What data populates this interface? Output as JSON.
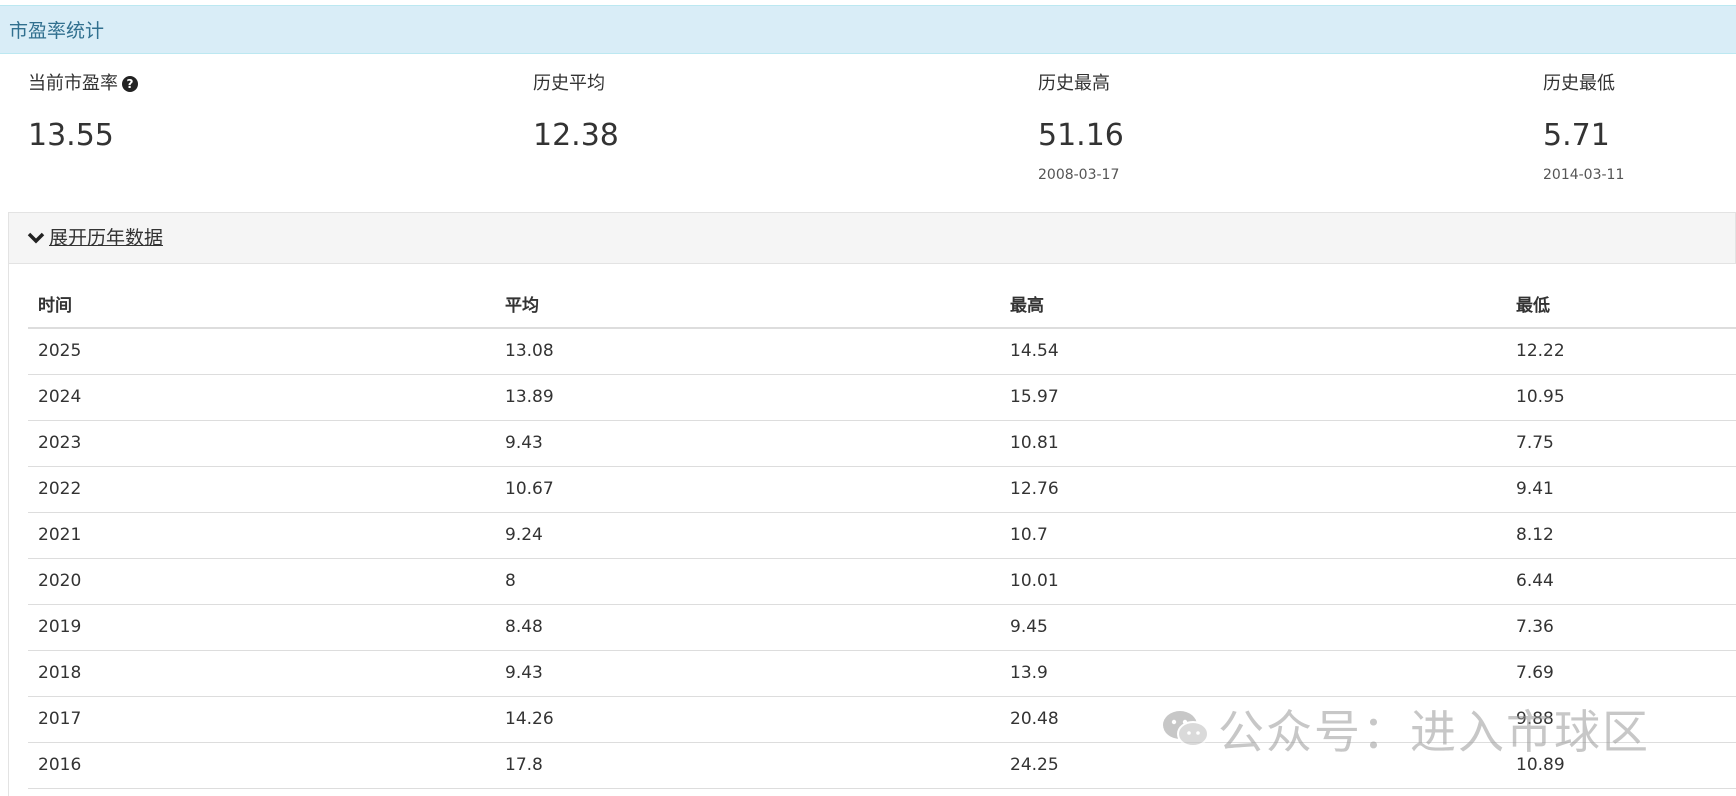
{
  "panel": {
    "title": "市盈率统计"
  },
  "stats": [
    {
      "label": "当前市盈率",
      "value": "13.55",
      "date": ""
    },
    {
      "label": "历史平均",
      "value": "12.38",
      "date": ""
    },
    {
      "label": "历史最高",
      "value": "51.16",
      "date": "2008-03-17"
    },
    {
      "label": "历史最低",
      "value": "5.71",
      "date": "2014-03-11"
    }
  ],
  "expand": {
    "label": "展开历年数据",
    "icon": "chevron-down-icon"
  },
  "table": {
    "headers": [
      "时间",
      "平均",
      "最高",
      "最低"
    ],
    "rows": [
      [
        "2025",
        "13.08",
        "14.54",
        "12.22"
      ],
      [
        "2024",
        "13.89",
        "15.97",
        "10.95"
      ],
      [
        "2023",
        "9.43",
        "10.81",
        "7.75"
      ],
      [
        "2022",
        "10.67",
        "12.76",
        "9.41"
      ],
      [
        "2021",
        "9.24",
        "10.7",
        "8.12"
      ],
      [
        "2020",
        "8",
        "10.01",
        "6.44"
      ],
      [
        "2019",
        "8.48",
        "9.45",
        "7.36"
      ],
      [
        "2018",
        "9.43",
        "13.9",
        "7.69"
      ],
      [
        "2017",
        "14.26",
        "20.48",
        "9.88"
      ],
      [
        "2016",
        "17.8",
        "24.25",
        "10.89"
      ]
    ]
  },
  "watermark": {
    "text": "公众号：进入市球区",
    "icon": "wechat-icon"
  },
  "colors": {
    "header_bg": "#d9edf7",
    "header_text": "#31708f",
    "expand_bg": "#f5f5f5"
  }
}
